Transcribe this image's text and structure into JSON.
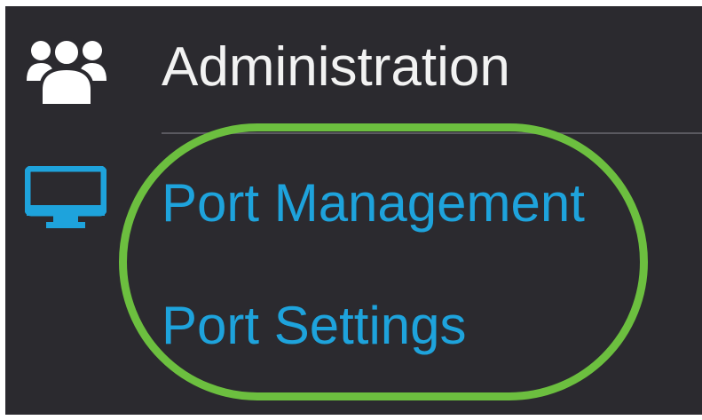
{
  "colors": {
    "background": "#2b2a2f",
    "admin_text": "#f2f2f2",
    "link_text": "#1ea3dc",
    "highlight": "#6cbf3f",
    "divider": "#5a5960"
  },
  "nav": {
    "administration": {
      "icon": "users-icon",
      "label": "Administration"
    },
    "port_management": {
      "icon": "monitor-icon",
      "label": "Port Management",
      "items": [
        {
          "label": "Port Settings"
        }
      ]
    }
  }
}
